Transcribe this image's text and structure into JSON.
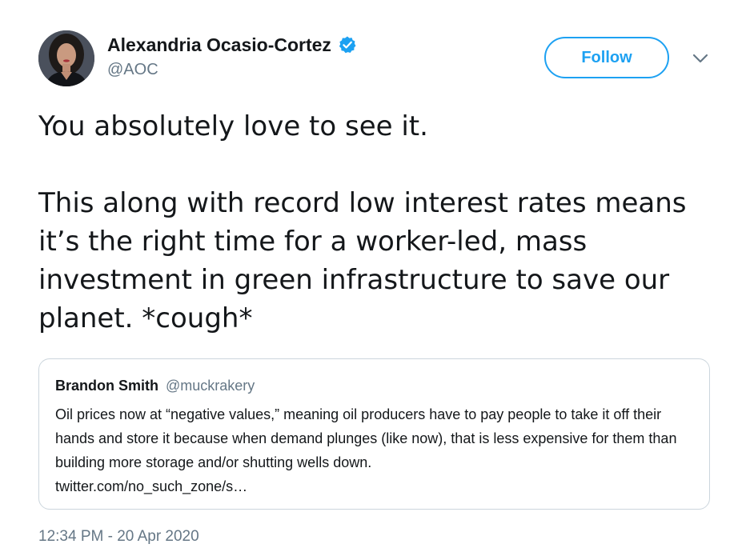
{
  "author": {
    "display_name": "Alexandria Ocasio-Cortez",
    "handle": "@AOC",
    "verified": true,
    "avatar_icon": "profile-photo"
  },
  "header": {
    "follow_label": "Follow",
    "menu_icon": "chevron-down-icon"
  },
  "tweet": {
    "paragraph_1": "You absolutely love to see it.",
    "paragraph_2": "This along with record low interest rates means it’s the right time for a worker-led, mass investment in green infrastructure to save our planet. *cough*",
    "timestamp": "12:34 PM - 20 Apr 2020"
  },
  "quoted_tweet": {
    "display_name": "Brandon Smith",
    "handle": "@muckrakery",
    "text": "Oil prices now at “negative values,” meaning oil producers have to pay people to take it off their hands and store it because when demand plunges (like now), that is less expensive for them than building more storage and/or shutting wells down.",
    "link": "twitter.com/no_such_zone/s…"
  },
  "colors": {
    "accent": "#1da1f2",
    "text_primary": "#14171a",
    "text_secondary": "#657786",
    "border": "#ccd6dd"
  }
}
